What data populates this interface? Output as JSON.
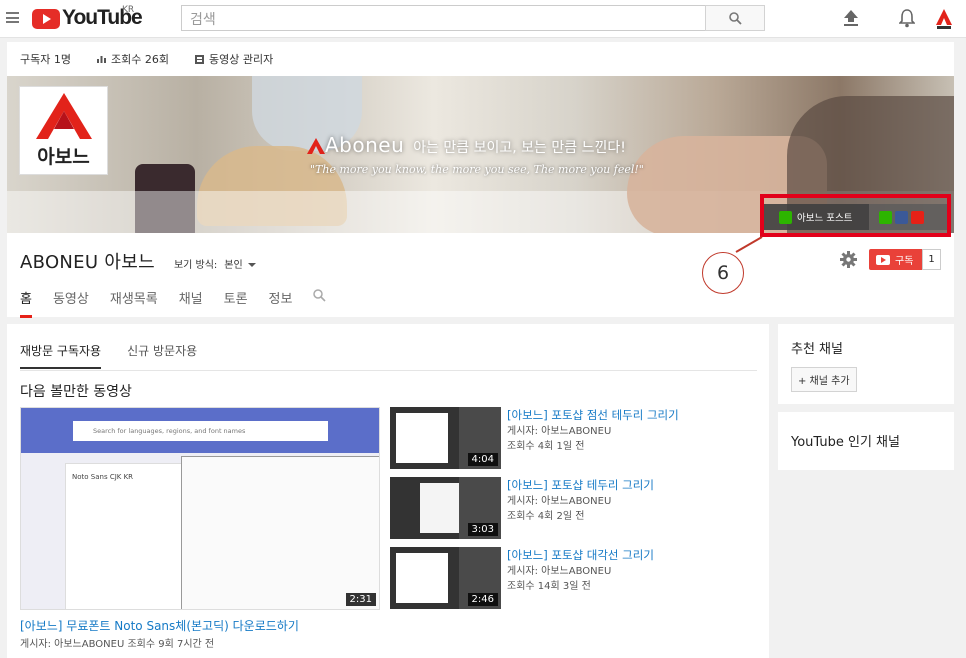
{
  "header": {
    "logo_text": "YouTube",
    "region": "KR",
    "search_placeholder": "검색"
  },
  "channel": {
    "stats": {
      "subscribers": "구독자 1명",
      "views": "조회수 26회",
      "manager": "동영상 관리자"
    },
    "logo_text": "아보느",
    "banner_brand": "Aboneu",
    "banner_tagline_ko": "아는 만큼 보이고, 보는 만큼 느낀다!",
    "banner_tagline_en": "\"The more you know, the more you see, The more you feel!\"",
    "post_link_label": "아보느 포스트",
    "name": "ABONEU 아보느",
    "view_as_label": "보기 방식:",
    "view_as_value": "본인",
    "subscribe_label": "구독",
    "subscribe_count": "1",
    "callout_number": "6",
    "tabs": [
      "홈",
      "동영상",
      "재생목록",
      "채널",
      "토론",
      "정보"
    ]
  },
  "main": {
    "subtabs": [
      "재방문 구독자용",
      "신규 방문자용"
    ],
    "section_title": "다음 볼만한 동영상",
    "featured": {
      "title": "[아보느] 무료폰트 Noto Sans체(본고딕) 다운로드하기",
      "meta": "게시자: 아보느ABONEU  조회수 9회  7시간 전",
      "duration": "2:31",
      "thumb_search": "Search for languages, regions, and font names",
      "thumb_font": "Noto Sans CJK KR"
    },
    "videos": [
      {
        "title": "[아보느] 포토샵 점선 테두리 그리기",
        "author": "게시자: 아보느ABONEU",
        "stats": "조회수 4회  1일 전",
        "duration": "4:04"
      },
      {
        "title": "[아보느] 포토샵 테두리 그리기",
        "author": "게시자: 아보느ABONEU",
        "stats": "조회수 4회  2일 전",
        "duration": "3:03"
      },
      {
        "title": "[아보느] 포토샵 대각선 그리기",
        "author": "게시자: 아보느ABONEU",
        "stats": "조회수 14회  3일 전",
        "duration": "2:46"
      }
    ]
  },
  "sidebar": {
    "recommended_title": "추천 채널",
    "add_channel": "+ 채널 추가",
    "popular_title": "YouTube 인기 채널"
  }
}
